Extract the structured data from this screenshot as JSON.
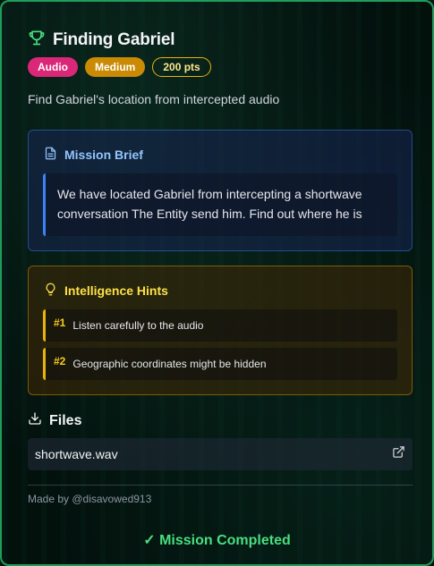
{
  "challenge": {
    "title": "Finding Gabriel",
    "category": "Audio",
    "difficulty": "Medium",
    "points": "200 pts",
    "description": "Find Gabriel's location from intercepted audio"
  },
  "brief": {
    "heading": "Mission Brief",
    "text": "We have located Gabriel from intercepting a shortwave conversation The Entity send him. Find out where he is"
  },
  "hints": {
    "heading": "Intelligence Hints",
    "items": [
      {
        "num": "#1",
        "text": "Listen carefully to the audio"
      },
      {
        "num": "#2",
        "text": "Geographic coordinates might be hidden"
      }
    ]
  },
  "files": {
    "heading": "Files",
    "items": [
      {
        "name": "shortwave.wav"
      }
    ]
  },
  "footer": {
    "credit": "Made by @disavowed913",
    "status": "✓ Mission Completed"
  },
  "colors": {
    "border": "#1f9d5c",
    "category_badge": "#db2777",
    "difficulty_badge": "#ca8a04",
    "brief_accent": "#3b82f6",
    "hint_accent": "#eab308",
    "completed": "#4ade80"
  },
  "icons": {
    "title": "trophy-icon",
    "brief": "document-icon",
    "hints": "lightbulb-icon",
    "files": "download-icon",
    "file_link": "external-link-icon"
  }
}
